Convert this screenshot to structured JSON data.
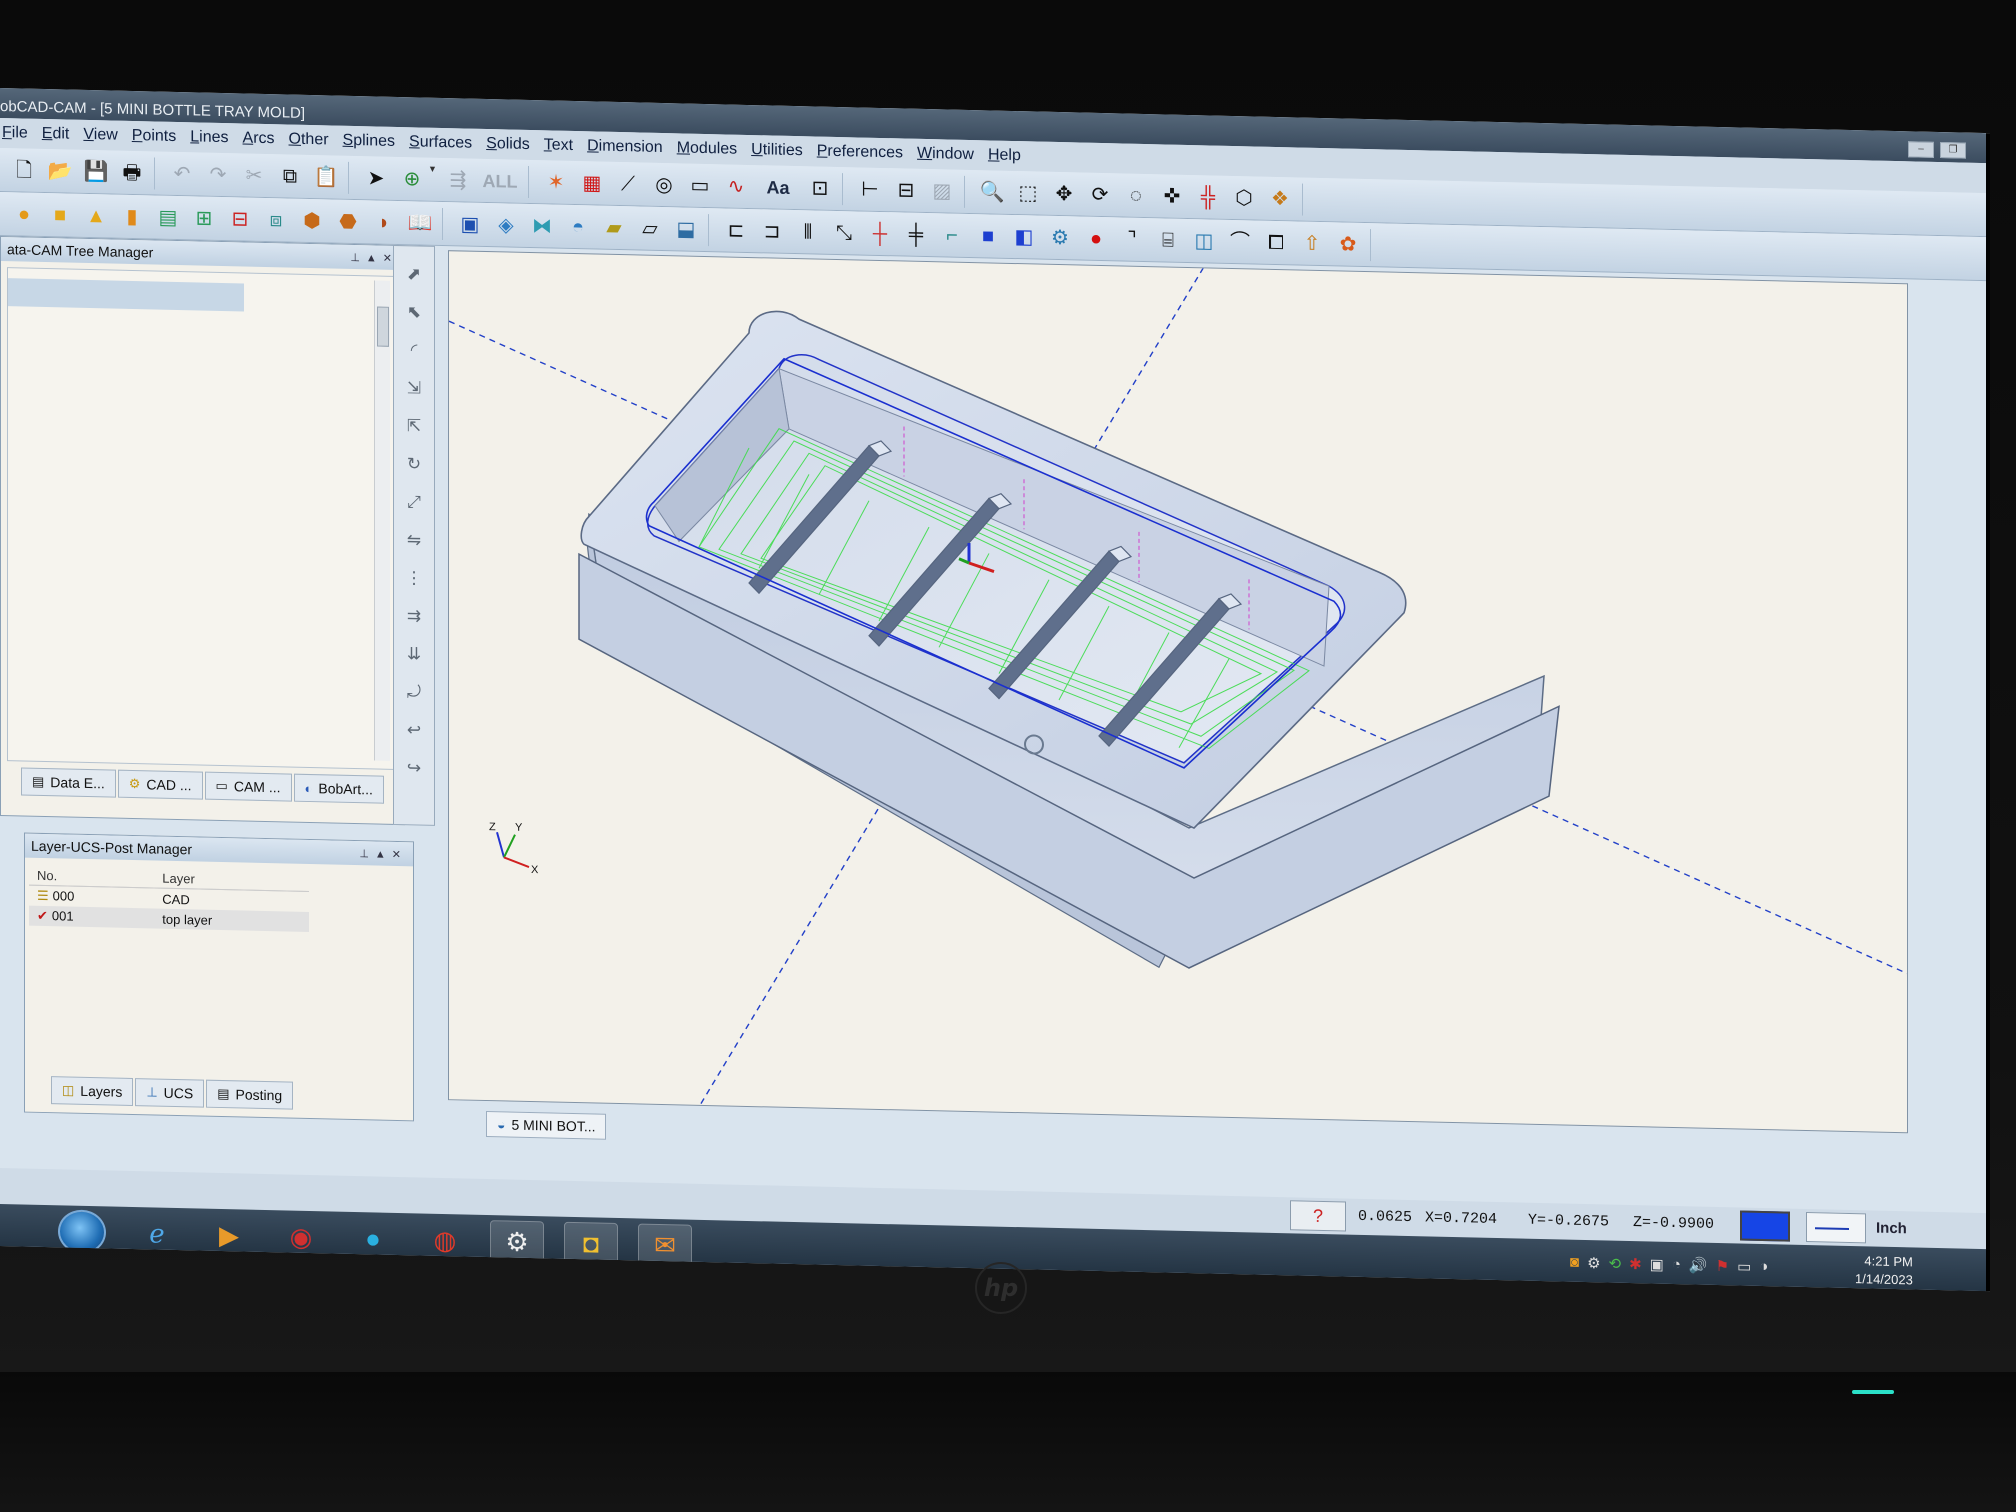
{
  "window": {
    "title": "obCAD-CAM - [5 MINI BOTTLE TRAY MOLD]"
  },
  "menu": [
    "File",
    "Edit",
    "View",
    "Points",
    "Lines",
    "Arcs",
    "Other",
    "Splines",
    "Surfaces",
    "Solids",
    "Text",
    "Dimension",
    "Modules",
    "Utilities",
    "Preferences",
    "Window",
    "Help"
  ],
  "toolbar": {
    "filter_label": "ALL",
    "text_tool_label": "Aa"
  },
  "tree_manager": {
    "title": "ata-CAM Tree Manager",
    "tabs": [
      {
        "label": "Data E...",
        "icon": "data-icon"
      },
      {
        "label": "CAD ...",
        "icon": "gear-icon"
      },
      {
        "label": "CAM ...",
        "icon": "cam-icon"
      },
      {
        "label": "BobArt...",
        "icon": "bobart-icon"
      }
    ]
  },
  "layer_manager": {
    "title": "Layer-UCS-Post Manager",
    "columns": [
      "No.",
      "Layer"
    ],
    "rows": [
      {
        "no": "000",
        "layer": "CAD"
      },
      {
        "no": "001",
        "layer": "top layer"
      }
    ],
    "tabs": [
      {
        "label": "Layers"
      },
      {
        "label": "UCS"
      },
      {
        "label": "Posting"
      }
    ]
  },
  "viewport": {
    "document_tab": "5 MINI BOT...",
    "axis_labels": [
      "Z",
      "Y",
      "X"
    ]
  },
  "status": {
    "increment": "0.0625",
    "x": "X=0.7204",
    "y": "Y=-0.2675",
    "z": "Z=-0.9900",
    "units": "Inch",
    "current_color": "#1645e6"
  },
  "taskbar": {
    "time": "4:21 PM",
    "date": "1/14/2023"
  },
  "colors": {
    "model_fill": "#c6d1e4",
    "toolpath": "#3ddc4a",
    "construction_line": "#2240c8",
    "profile_line": "#1a2fd0",
    "highlight": "#d050d0"
  }
}
